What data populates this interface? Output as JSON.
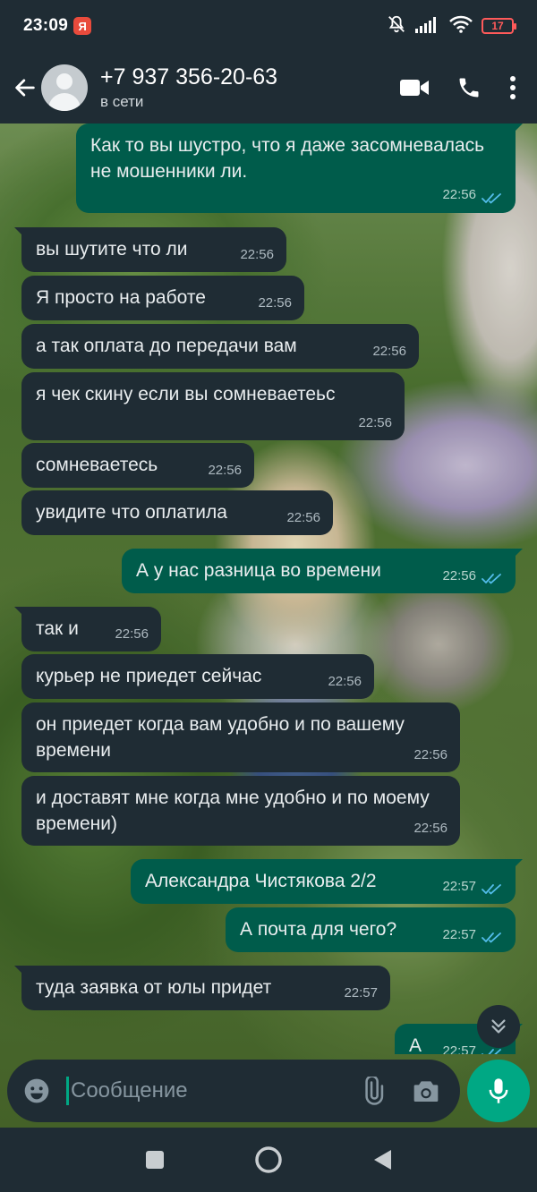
{
  "statusbar": {
    "time": "23:09",
    "yandex_badge": "Я",
    "battery": "17",
    "icons": [
      "mute-icon",
      "signal-icon",
      "wifi-icon",
      "battery-icon"
    ]
  },
  "header": {
    "contact_name": "+7 937 356-20-63",
    "contact_status": "в сети",
    "icons": [
      "back-arrow-icon",
      "video-call-icon",
      "phone-icon",
      "more-vert-icon"
    ]
  },
  "messages": [
    {
      "dir": "out",
      "text": "Как  то вы шустро, что я даже засомневалась не мошенники ли.",
      "time": "22:56",
      "read": true
    },
    {
      "dir": "in",
      "text": "вы шутите что ли",
      "time": "22:56"
    },
    {
      "dir": "in",
      "text": "Я просто на работе",
      "time": "22:56"
    },
    {
      "dir": "in",
      "text": "а так оплата до передачи вам",
      "time": "22:56"
    },
    {
      "dir": "in",
      "text": "я чек скину если вы сомневаетеьс",
      "time": "22:56"
    },
    {
      "dir": "in",
      "text": "сомневаетесь",
      "time": "22:56"
    },
    {
      "dir": "in",
      "text": "увидите что оплатила",
      "time": "22:56"
    },
    {
      "dir": "out",
      "text": "А у нас разница во времени",
      "time": "22:56",
      "read": true
    },
    {
      "dir": "in",
      "text": "так и",
      "time": "22:56"
    },
    {
      "dir": "in",
      "text": "курьер не приедет сейчас",
      "time": "22:56"
    },
    {
      "dir": "in",
      "text": "он приедет когда вам удобно и по вашему времени",
      "time": "22:56"
    },
    {
      "dir": "in",
      "text": "и доставят мне когда мне удобно и по моему времени)",
      "time": "22:56"
    },
    {
      "dir": "out",
      "text": "Александра Чистякова 2/2",
      "time": "22:57",
      "read": true
    },
    {
      "dir": "out",
      "text": "А почта для чего?",
      "time": "22:57",
      "read": true
    },
    {
      "dir": "in",
      "text": "туда заявка от юлы придет",
      "time": "22:57"
    },
    {
      "dir": "out",
      "text": "А",
      "time": "22:57",
      "read": true
    }
  ],
  "composer": {
    "placeholder": "Сообщение",
    "value": "",
    "icons": [
      "emoji-icon",
      "attach-icon",
      "camera-icon",
      "mic-icon"
    ]
  },
  "colors": {
    "header_bg": "#1f2c34",
    "incoming_bubble": "#1f2c34",
    "outgoing_bubble": "#005c4b",
    "accent": "#00a884",
    "read_ticks": "#53bdeb"
  }
}
